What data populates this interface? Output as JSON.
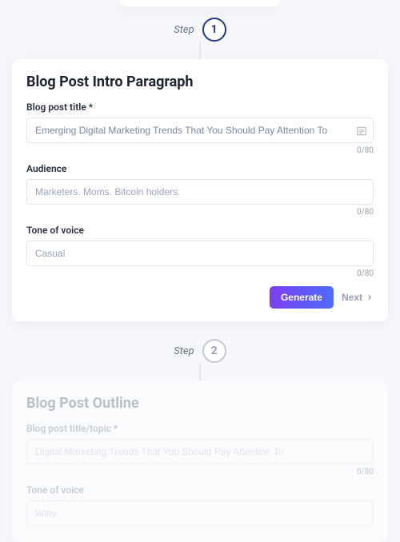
{
  "steps": {
    "label": "Step",
    "n1": "1",
    "n2": "2"
  },
  "card1": {
    "title": "Blog Post Intro Paragraph",
    "f1": {
      "label": "Blog post title *",
      "value": "Emerging Digital Marketing Trends That You Should Pay Attention To",
      "counter": "0/80"
    },
    "f2": {
      "label": "Audience",
      "placeholder": "Marketers. Moms. Bitcoin holders.",
      "counter": "0/80"
    },
    "f3": {
      "label": "Tone of voice",
      "placeholder": "Casual",
      "counter": "0/80"
    },
    "actions": {
      "generate": "Generate",
      "next": "Next"
    }
  },
  "card2": {
    "title": "Blog Post Outline",
    "f1": {
      "label": "Blog post title/topic *",
      "value": "Digital Marketing Trends That You Should Pay Attention To",
      "counter": "0/80"
    },
    "f2": {
      "label": "Tone of voice",
      "value": "Witty"
    }
  }
}
